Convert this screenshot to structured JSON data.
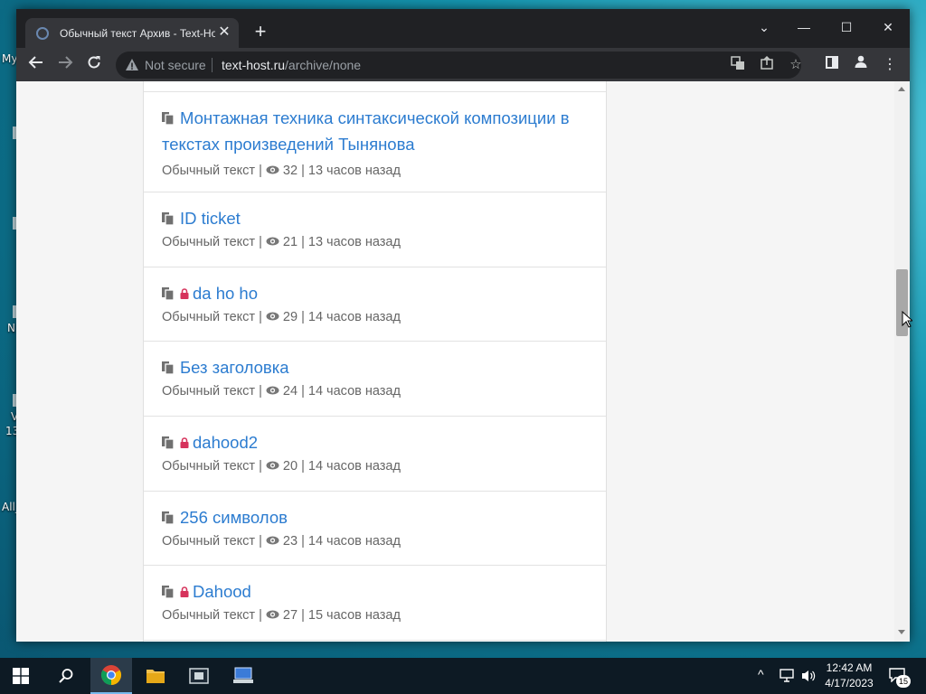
{
  "desktop": {
    "labels": [
      "My",
      "N",
      "V",
      "13",
      "All_"
    ]
  },
  "browser": {
    "tab_title": "Обычный текст Архив - Text-Ho",
    "not_secure": "Not secure",
    "url_host": "text-host.ru",
    "url_path": "/archive/none"
  },
  "items": [
    {
      "title": "Монтажная техника синтаксической композиции в текстах произведений Тынянова",
      "locked": false,
      "type": "Обычный текст",
      "views": "32",
      "time": "13 часов назад"
    },
    {
      "title": "ID ticket",
      "locked": false,
      "type": "Обычный текст",
      "views": "21",
      "time": "13 часов назад"
    },
    {
      "title": "da ho ho",
      "locked": true,
      "type": "Обычный текст",
      "views": "29",
      "time": "14 часов назад"
    },
    {
      "title": "Без заголовка",
      "locked": false,
      "type": "Обычный текст",
      "views": "24",
      "time": "14 часов назад"
    },
    {
      "title": "dahood2",
      "locked": true,
      "type": "Обычный текст",
      "views": "20",
      "time": "14 часов назад"
    },
    {
      "title": "256 символов",
      "locked": false,
      "type": "Обычный текст",
      "views": "23",
      "time": "14 часов назад"
    },
    {
      "title": "Dahood",
      "locked": true,
      "type": "Обычный текст",
      "views": "27",
      "time": "15 часов назад"
    }
  ],
  "taskbar": {
    "time": "12:42 AM",
    "date": "4/17/2023",
    "notifications": "15"
  },
  "colors": {
    "link": "#2c7cd0",
    "lock": "#d6335c"
  }
}
